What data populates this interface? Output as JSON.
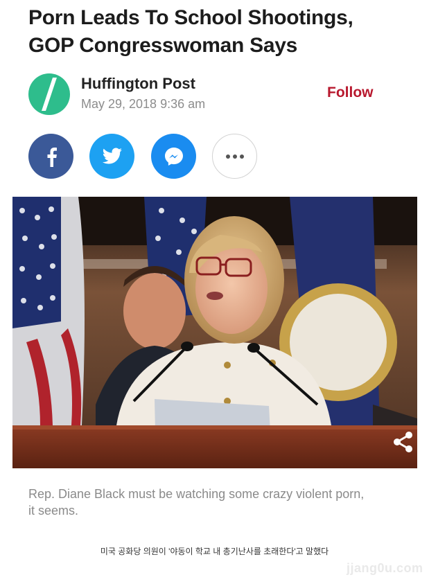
{
  "article": {
    "headline_line1": "Porn Leads To School Shootings,",
    "headline_line2": "GOP Congresswoman Says",
    "caption_line1": "Rep. Diane Black must be watching some crazy violent porn,",
    "caption_line2": "it seems."
  },
  "publisher": {
    "name": "Huffington Post",
    "date": "May 29, 2018 9:36 am",
    "follow_label": "Follow",
    "logo_icon": "huffpost-slash-logo",
    "brand_color": "#2ebd8c"
  },
  "share": {
    "buttons": [
      {
        "icon": "facebook-icon",
        "color": "#3b5998"
      },
      {
        "icon": "twitter-icon",
        "color": "#1da1f2"
      },
      {
        "icon": "messenger-icon",
        "color": "#1a8cf0"
      },
      {
        "icon": "more-icon",
        "color": "#ffffff"
      }
    ]
  },
  "overlay": {
    "korean_caption": "미국 공화당 의원이 '야동이 학교 내 총기난사를 초래한다'고 말했다",
    "watermark": "jjang0u.com"
  },
  "colors": {
    "follow": "#b8182e",
    "caption": "#8a8a8a"
  }
}
